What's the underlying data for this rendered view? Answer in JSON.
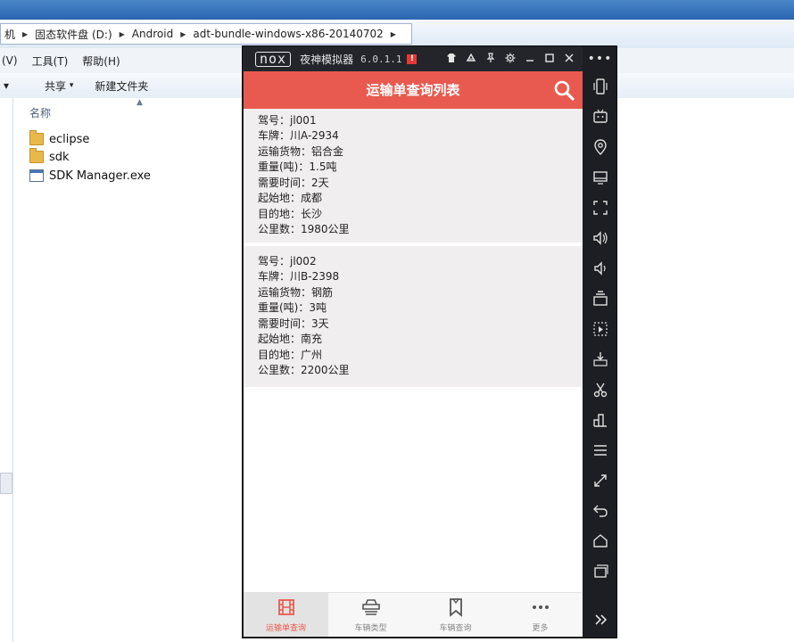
{
  "explorer": {
    "breadcrumb": [
      "机",
      "固态软件盘 (D:)",
      "Android",
      "adt-bundle-windows-x86-20140702"
    ],
    "menu": [
      "(V)",
      "工具(T)",
      "帮助(H)"
    ],
    "toolbar": {
      "share": "共享",
      "new_folder": "新建文件夹"
    },
    "column_name": "名称",
    "files": [
      {
        "name": "eclipse",
        "type": "folder"
      },
      {
        "name": "sdk",
        "type": "folder"
      },
      {
        "name": "SDK Manager.exe",
        "type": "exe"
      }
    ]
  },
  "emulator": {
    "logo": "nox",
    "name": "夜神模拟器",
    "version": "6.0.1.1",
    "alert": "!"
  },
  "app": {
    "title": "运输单查询列表",
    "accent": "#e85a4f",
    "records": [
      {
        "driver": "驾号：jl001",
        "plate": "车牌：川A-2934",
        "cargo": "运输货物：铝合金",
        "weight": "重量(吨)：1.5吨",
        "duration": "需要时间：2天",
        "origin": "起始地：成都",
        "destination": "目的地：长沙",
        "distance": "公里数：1980公里"
      },
      {
        "driver": "驾号：jl002",
        "plate": "车牌：川B-2398",
        "cargo": "运输货物：钢筋",
        "weight": "重量(吨)：3吨",
        "duration": "需要时间：3天",
        "origin": "起始地：南充",
        "destination": "目的地：广州",
        "distance": "公里数：2200公里"
      }
    ],
    "tabs": [
      {
        "label": "运输单查询",
        "icon": "film-icon",
        "active": true
      },
      {
        "label": "车辆类型",
        "icon": "car-icon",
        "active": false
      },
      {
        "label": "车辆查询",
        "icon": "bookmark-icon",
        "active": false
      },
      {
        "label": "更多",
        "icon": "more-icon",
        "active": false
      }
    ]
  }
}
